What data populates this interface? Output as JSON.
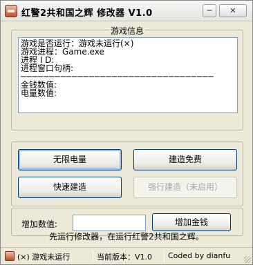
{
  "window": {
    "title": "红警2共和国之辉  修改器 V1.0",
    "minimize_glyph": "─",
    "close_glyph": "✕"
  },
  "info_panel": {
    "legend": "游戏信息",
    "lines": [
      "游戏是否运行：游戏未运行(×)",
      "游戏进程：Game.exe",
      "进程 I D:",
      "进程窗口句柄:"
    ],
    "separator": "──────────────────────────────────",
    "money_label": "金钱数值:",
    "power_label": "电量数值:"
  },
  "buttons": {
    "unlimited_power": "无限电量",
    "free_build": "建造免费",
    "fast_build": "快速建造",
    "force_build": "强行建造（未启用）"
  },
  "add_money": {
    "label": "增加数值:",
    "input_value": "",
    "button": "增加金钱"
  },
  "hint": "先运行修改器，在运行红警2共和国之辉。",
  "statusbar": {
    "status": "(×) 游戏未运行",
    "version": "当前版本：V1.0",
    "credit": "Coded by dianfu"
  }
}
